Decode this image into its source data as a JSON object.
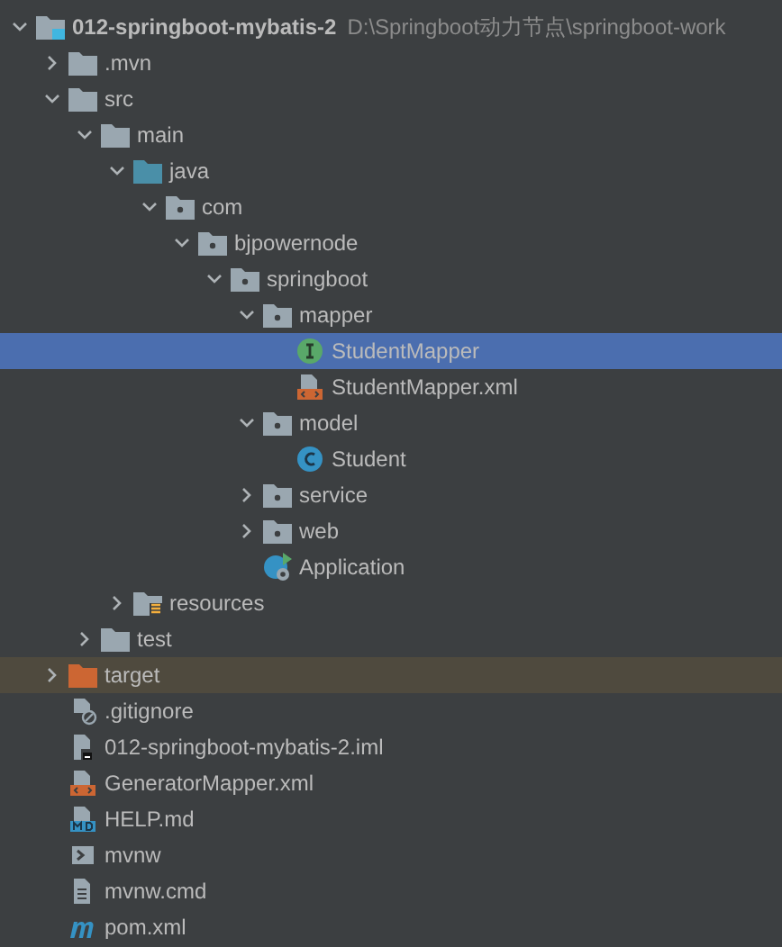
{
  "tree": [
    {
      "name": "012-springboot-mybatis-2",
      "path": "D:\\Springboot动力节点\\springboot-work",
      "kind": "module",
      "expanded": true,
      "selected": false,
      "children": [
        {
          "name": ".mvn",
          "kind": "folder",
          "expanded": false,
          "selected": false
        },
        {
          "name": "src",
          "kind": "folder",
          "expanded": true,
          "selected": false,
          "children": [
            {
              "name": "main",
              "kind": "folder",
              "expanded": true,
              "selected": false,
              "children": [
                {
                  "name": "java",
                  "kind": "source-folder",
                  "expanded": true,
                  "selected": false,
                  "children": [
                    {
                      "name": "com",
                      "kind": "package",
                      "expanded": true,
                      "selected": false,
                      "children": [
                        {
                          "name": "bjpowernode",
                          "kind": "package",
                          "expanded": true,
                          "selected": false,
                          "children": [
                            {
                              "name": "springboot",
                              "kind": "package",
                              "expanded": true,
                              "selected": false,
                              "children": [
                                {
                                  "name": "mapper",
                                  "kind": "package",
                                  "expanded": true,
                                  "selected": false,
                                  "children": [
                                    {
                                      "name": "StudentMapper",
                                      "kind": "interface",
                                      "selected": true
                                    },
                                    {
                                      "name": "StudentMapper.xml",
                                      "kind": "xml",
                                      "selected": false
                                    }
                                  ]
                                },
                                {
                                  "name": "model",
                                  "kind": "package",
                                  "expanded": true,
                                  "selected": false,
                                  "children": [
                                    {
                                      "name": "Student",
                                      "kind": "class",
                                      "selected": false
                                    }
                                  ]
                                },
                                {
                                  "name": "service",
                                  "kind": "package",
                                  "expanded": false,
                                  "selected": false
                                },
                                {
                                  "name": "web",
                                  "kind": "package",
                                  "expanded": false,
                                  "selected": false
                                },
                                {
                                  "name": "Application",
                                  "kind": "app",
                                  "selected": false
                                }
                              ]
                            }
                          ]
                        }
                      ]
                    }
                  ]
                },
                {
                  "name": "resources",
                  "kind": "resources-folder",
                  "expanded": false,
                  "selected": false
                }
              ]
            },
            {
              "name": "test",
              "kind": "folder",
              "expanded": false,
              "selected": false
            }
          ]
        },
        {
          "name": "target",
          "kind": "excluded-folder",
          "expanded": false,
          "selected": false
        },
        {
          "name": ".gitignore",
          "kind": "ignore-file",
          "selected": false
        },
        {
          "name": "012-springboot-mybatis-2.iml",
          "kind": "iml",
          "selected": false
        },
        {
          "name": "GeneratorMapper.xml",
          "kind": "xml",
          "selected": false
        },
        {
          "name": "HELP.md",
          "kind": "markdown",
          "selected": false
        },
        {
          "name": "mvnw",
          "kind": "shell",
          "selected": false
        },
        {
          "name": "mvnw.cmd",
          "kind": "text-file",
          "selected": false
        },
        {
          "name": "pom.xml",
          "kind": "maven",
          "selected": false
        }
      ]
    }
  ]
}
